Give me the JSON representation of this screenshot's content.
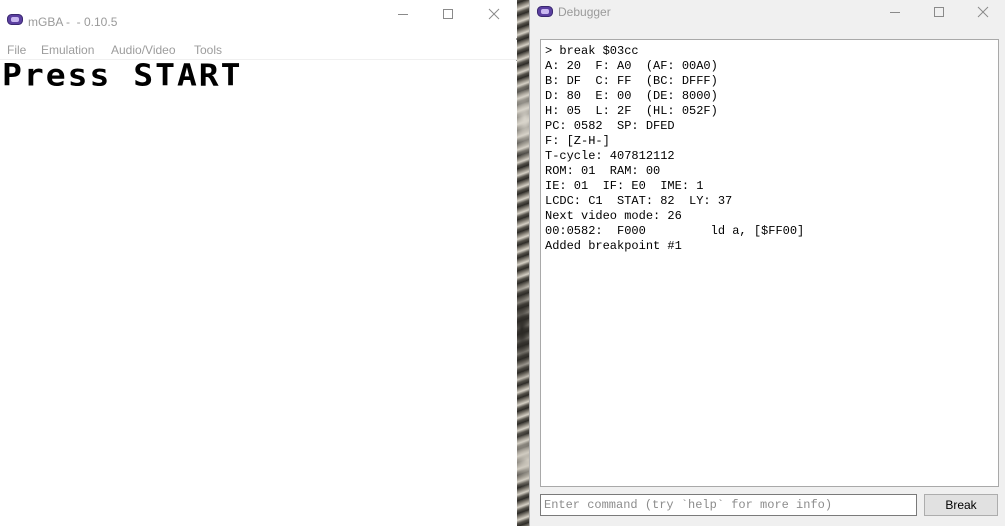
{
  "mgba": {
    "title": "mGBA -  - 0.10.5",
    "menu": [
      "File",
      "Emulation",
      "Audio/Video",
      "Tools"
    ],
    "screen_text": "Press START",
    "icons": [
      "mgba-app-icon",
      "minimize-icon",
      "maximize-icon",
      "close-icon"
    ]
  },
  "debugger": {
    "title": "Debugger",
    "console_lines": [
      "> break $03cc",
      "A: 20  F: A0  (AF: 00A0)",
      "B: DF  C: FF  (BC: DFFF)",
      "D: 80  E: 00  (DE: 8000)",
      "H: 05  L: 2F  (HL: 052F)",
      "PC: 0582  SP: DFED",
      "F: [Z-H-]",
      "T-cycle: 407812112",
      "ROM: 01  RAM: 00",
      "IE: 01  IF: E0  IME: 1",
      "LCDC: C1  STAT: 82  LY: 37",
      "Next video mode: 26",
      "00:0582:  F000         ld a, [$FF00]",
      "Added breakpoint #1"
    ],
    "command_placeholder": "Enter command (try `help` for more info)",
    "command_value": "",
    "break_label": "Break"
  },
  "colors": {
    "titlebar_text": "#9a9a9a",
    "menu_text": "#9c9c9c",
    "icon_purple": "#5b3fa0"
  }
}
